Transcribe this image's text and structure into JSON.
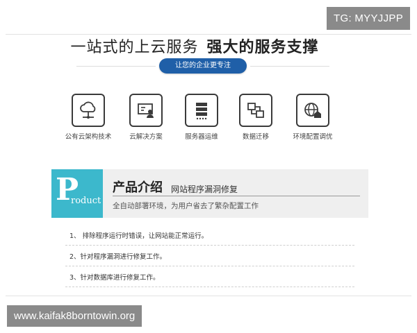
{
  "watermark_top": "TG: MYYJJPP",
  "headline": {
    "lead": "一站式的上云服务",
    "strong": "强大的服务支撑"
  },
  "cta": {
    "label": "让您的企业更专注"
  },
  "features": [
    {
      "label": "公有云架构技术",
      "icon": "cloud-network-icon"
    },
    {
      "label": "云解决方案",
      "icon": "screen-user-icon"
    },
    {
      "label": "服务器运维",
      "icon": "server-rack-icon"
    },
    {
      "label": "数据迁移",
      "icon": "data-transfer-icon"
    },
    {
      "label": "环境配置调优",
      "icon": "globe-home-icon"
    }
  ],
  "product": {
    "badge_big": "P",
    "badge_rest": "roduct",
    "title_main": "产品介绍",
    "title_sub": "网站程序漏洞修复",
    "description": "全自动部署环境，为用户省去了繁杂配置工作"
  },
  "list": [
    {
      "text": "1、 排除程序运行时错误，让网站能正常运行。"
    },
    {
      "text": "2、针对程序漏洞进行修复工作。"
    },
    {
      "text": "3、针对数据库进行修复工作。"
    }
  ],
  "watermark_bottom": "www.kaifak8borntowin.org",
  "colors": {
    "accent": "#1f5fa8",
    "badge": "#3cb8cc",
    "watermark_bg": "#8a8a8a"
  }
}
